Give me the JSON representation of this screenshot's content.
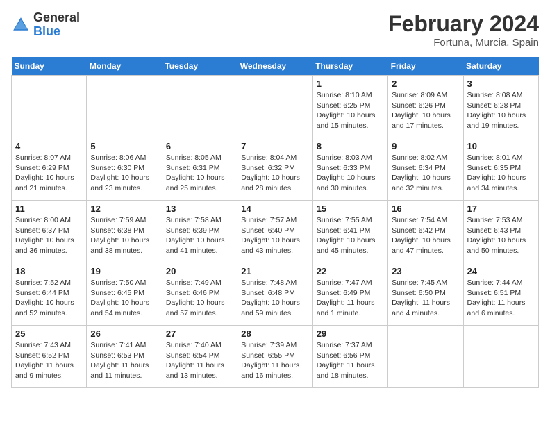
{
  "header": {
    "logo_line1": "General",
    "logo_line2": "Blue",
    "title": "February 2024",
    "subtitle": "Fortuna, Murcia, Spain"
  },
  "days_of_week": [
    "Sunday",
    "Monday",
    "Tuesday",
    "Wednesday",
    "Thursday",
    "Friday",
    "Saturday"
  ],
  "weeks": [
    [
      {
        "date": "",
        "info": ""
      },
      {
        "date": "",
        "info": ""
      },
      {
        "date": "",
        "info": ""
      },
      {
        "date": "",
        "info": ""
      },
      {
        "date": "1",
        "info": "Sunrise: 8:10 AM\nSunset: 6:25 PM\nDaylight: 10 hours\nand 15 minutes."
      },
      {
        "date": "2",
        "info": "Sunrise: 8:09 AM\nSunset: 6:26 PM\nDaylight: 10 hours\nand 17 minutes."
      },
      {
        "date": "3",
        "info": "Sunrise: 8:08 AM\nSunset: 6:28 PM\nDaylight: 10 hours\nand 19 minutes."
      }
    ],
    [
      {
        "date": "4",
        "info": "Sunrise: 8:07 AM\nSunset: 6:29 PM\nDaylight: 10 hours\nand 21 minutes."
      },
      {
        "date": "5",
        "info": "Sunrise: 8:06 AM\nSunset: 6:30 PM\nDaylight: 10 hours\nand 23 minutes."
      },
      {
        "date": "6",
        "info": "Sunrise: 8:05 AM\nSunset: 6:31 PM\nDaylight: 10 hours\nand 25 minutes."
      },
      {
        "date": "7",
        "info": "Sunrise: 8:04 AM\nSunset: 6:32 PM\nDaylight: 10 hours\nand 28 minutes."
      },
      {
        "date": "8",
        "info": "Sunrise: 8:03 AM\nSunset: 6:33 PM\nDaylight: 10 hours\nand 30 minutes."
      },
      {
        "date": "9",
        "info": "Sunrise: 8:02 AM\nSunset: 6:34 PM\nDaylight: 10 hours\nand 32 minutes."
      },
      {
        "date": "10",
        "info": "Sunrise: 8:01 AM\nSunset: 6:35 PM\nDaylight: 10 hours\nand 34 minutes."
      }
    ],
    [
      {
        "date": "11",
        "info": "Sunrise: 8:00 AM\nSunset: 6:37 PM\nDaylight: 10 hours\nand 36 minutes."
      },
      {
        "date": "12",
        "info": "Sunrise: 7:59 AM\nSunset: 6:38 PM\nDaylight: 10 hours\nand 38 minutes."
      },
      {
        "date": "13",
        "info": "Sunrise: 7:58 AM\nSunset: 6:39 PM\nDaylight: 10 hours\nand 41 minutes."
      },
      {
        "date": "14",
        "info": "Sunrise: 7:57 AM\nSunset: 6:40 PM\nDaylight: 10 hours\nand 43 minutes."
      },
      {
        "date": "15",
        "info": "Sunrise: 7:55 AM\nSunset: 6:41 PM\nDaylight: 10 hours\nand 45 minutes."
      },
      {
        "date": "16",
        "info": "Sunrise: 7:54 AM\nSunset: 6:42 PM\nDaylight: 10 hours\nand 47 minutes."
      },
      {
        "date": "17",
        "info": "Sunrise: 7:53 AM\nSunset: 6:43 PM\nDaylight: 10 hours\nand 50 minutes."
      }
    ],
    [
      {
        "date": "18",
        "info": "Sunrise: 7:52 AM\nSunset: 6:44 PM\nDaylight: 10 hours\nand 52 minutes."
      },
      {
        "date": "19",
        "info": "Sunrise: 7:50 AM\nSunset: 6:45 PM\nDaylight: 10 hours\nand 54 minutes."
      },
      {
        "date": "20",
        "info": "Sunrise: 7:49 AM\nSunset: 6:46 PM\nDaylight: 10 hours\nand 57 minutes."
      },
      {
        "date": "21",
        "info": "Sunrise: 7:48 AM\nSunset: 6:48 PM\nDaylight: 10 hours\nand 59 minutes."
      },
      {
        "date": "22",
        "info": "Sunrise: 7:47 AM\nSunset: 6:49 PM\nDaylight: 11 hours\nand 1 minute."
      },
      {
        "date": "23",
        "info": "Sunrise: 7:45 AM\nSunset: 6:50 PM\nDaylight: 11 hours\nand 4 minutes."
      },
      {
        "date": "24",
        "info": "Sunrise: 7:44 AM\nSunset: 6:51 PM\nDaylight: 11 hours\nand 6 minutes."
      }
    ],
    [
      {
        "date": "25",
        "info": "Sunrise: 7:43 AM\nSunset: 6:52 PM\nDaylight: 11 hours\nand 9 minutes."
      },
      {
        "date": "26",
        "info": "Sunrise: 7:41 AM\nSunset: 6:53 PM\nDaylight: 11 hours\nand 11 minutes."
      },
      {
        "date": "27",
        "info": "Sunrise: 7:40 AM\nSunset: 6:54 PM\nDaylight: 11 hours\nand 13 minutes."
      },
      {
        "date": "28",
        "info": "Sunrise: 7:39 AM\nSunset: 6:55 PM\nDaylight: 11 hours\nand 16 minutes."
      },
      {
        "date": "29",
        "info": "Sunrise: 7:37 AM\nSunset: 6:56 PM\nDaylight: 11 hours\nand 18 minutes."
      },
      {
        "date": "",
        "info": ""
      },
      {
        "date": "",
        "info": ""
      }
    ]
  ]
}
